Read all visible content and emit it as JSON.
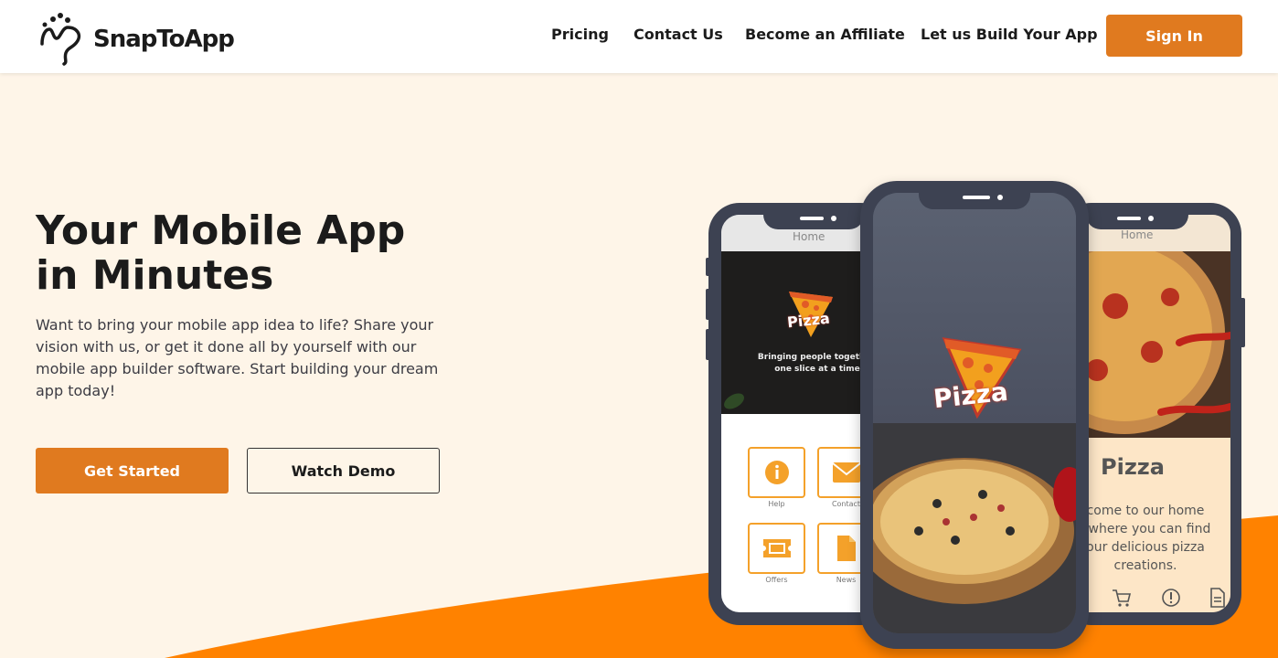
{
  "header": {
    "brand": "SnapToApp",
    "nav": [
      "Pricing",
      "Contact Us",
      "Become an Affiliate",
      "Let us Build Your App"
    ],
    "signin_label": "Sign In"
  },
  "hero": {
    "title_line1": "Your Mobile App",
    "title_line2": "in Minutes",
    "description": "Want to bring your mobile app idea to life? Share your vision with us, or get it done all by yourself with our mobile app builder software. Start building your dream app today!",
    "primary_cta": "Get Started",
    "secondary_cta": "Watch Demo"
  },
  "phones": {
    "left": {
      "title": "Home",
      "tagline_1": "Bringing people together,",
      "tagline_2": "one slice at a time",
      "logo_text": "Pizza",
      "tiles": [
        {
          "label": "Help",
          "icon": "info-icon"
        },
        {
          "label": "Contact",
          "icon": "mail-icon"
        },
        {
          "label": "Offers",
          "icon": "ticket-icon"
        },
        {
          "label": "News",
          "icon": "document-icon"
        }
      ]
    },
    "center": {
      "logo_text": "Pizza"
    },
    "right": {
      "title": "Home",
      "heading": "Pizza",
      "body_1": "come to our home",
      "body_2": ", where you can find",
      "body_3": "our delicious pizza",
      "body_4": "creations."
    }
  },
  "colors": {
    "accent": "#e07a1f",
    "background": "#fef5e8",
    "wave": "#ff8200",
    "phone_frame": "#3d4252",
    "icon_yellow": "#f4a12a"
  }
}
